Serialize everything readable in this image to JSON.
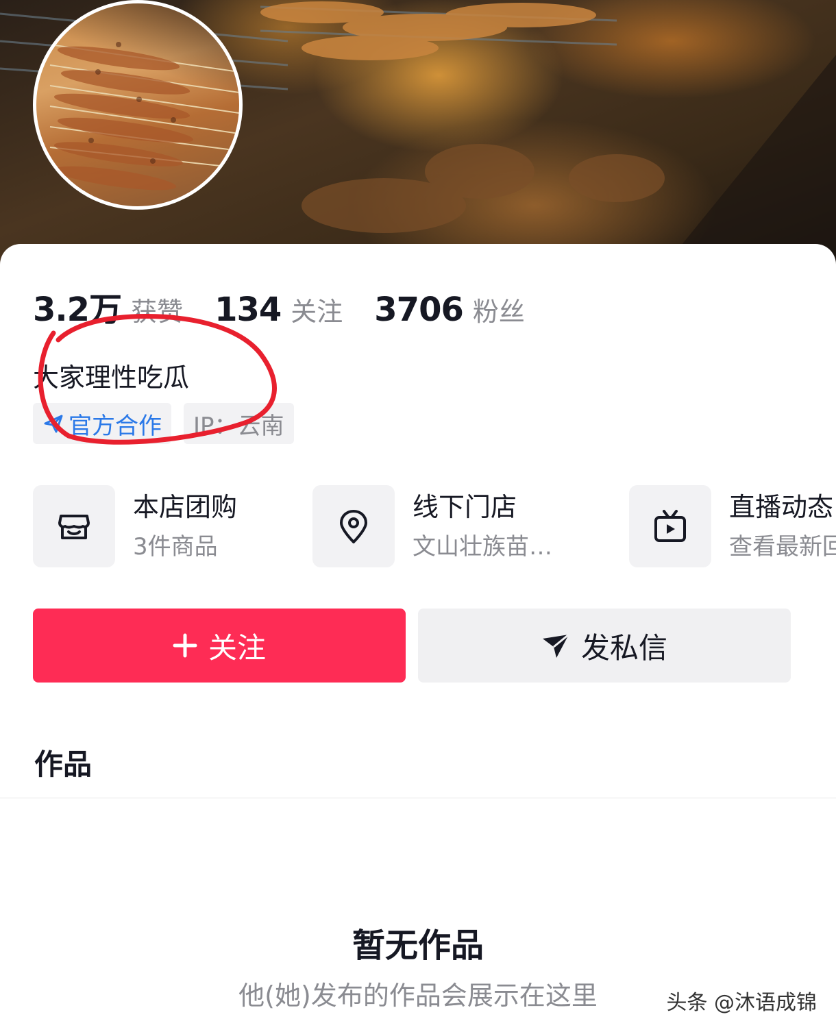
{
  "profile": {
    "stats": [
      {
        "value": "3.2万",
        "label": "获赞"
      },
      {
        "value": "134",
        "label": "关注"
      },
      {
        "value": "3706",
        "label": "粉丝"
      }
    ],
    "bio": "大家理性吃瓜",
    "tags": {
      "official": "官方合作",
      "ip": "IP：云南"
    }
  },
  "services": [
    {
      "title": "本店团购",
      "subtitle": "3件商品",
      "icon": "store-icon"
    },
    {
      "title": "线下门店",
      "subtitle": "文山壮族苗…",
      "icon": "location-pin-icon"
    },
    {
      "title": "直播动态",
      "subtitle": "查看最新回",
      "icon": "tv-icon"
    }
  ],
  "actions": {
    "follow": "关注",
    "message": "发私信"
  },
  "works": {
    "tab": "作品",
    "empty_title": "暂无作品",
    "empty_subtitle": "他(她)发布的作品会展示在这里"
  },
  "watermark": "头条 @沐语成锦",
  "colors": {
    "accent": "#fe2c55",
    "official_blue": "#2b79e8",
    "annotation_red": "#e8202e",
    "muted_text": "#8a8b91"
  }
}
